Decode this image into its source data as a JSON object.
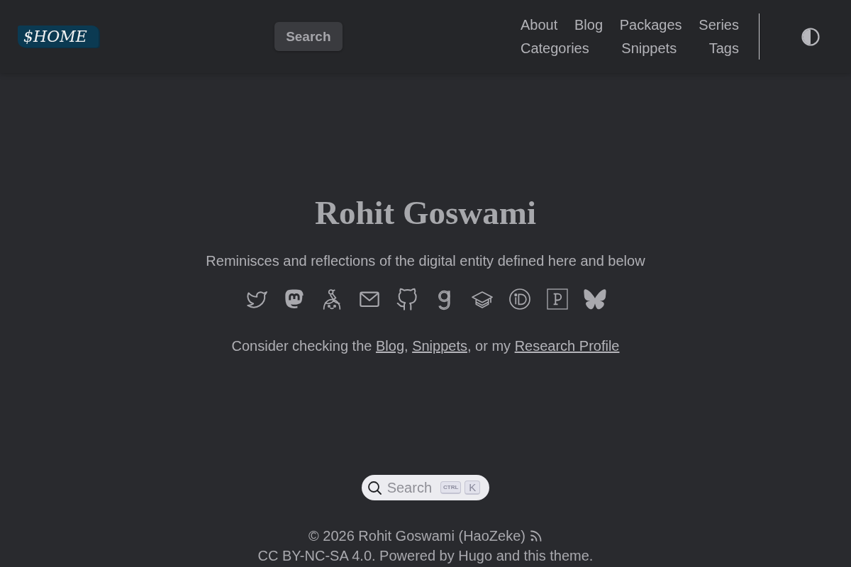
{
  "header": {
    "logo": "$HOME",
    "search_button": "Search",
    "nav": [
      "About",
      "Blog",
      "Packages",
      "Series",
      "Categories",
      "Snippets",
      "Tags"
    ]
  },
  "hero": {
    "title": "Rohit Goswami",
    "subtitle": "Reminisces and reflections of the digital entity defined here and below",
    "social_links": [
      {
        "kind": "bird"
      },
      {
        "kind": "bubble-m"
      },
      {
        "kind": "figure"
      },
      {
        "kind": "envelope"
      },
      {
        "kind": "cat"
      },
      {
        "kind": "letter-g"
      },
      {
        "kind": "mortarboard"
      },
      {
        "kind": "id-circle"
      },
      {
        "kind": "p-square"
      },
      {
        "kind": "butterfly"
      }
    ],
    "cta": [
      {
        "kind": "text",
        "text": "Consider checking the "
      },
      {
        "kind": "link",
        "text": "Blog"
      },
      {
        "kind": "text",
        "text": ", "
      },
      {
        "kind": "link",
        "text": "Snippets"
      },
      {
        "kind": "text",
        "text": ", or my "
      },
      {
        "kind": "link",
        "text": "Research Profile"
      }
    ]
  },
  "search_button": {
    "label": "Search",
    "keys": [
      "CTRL",
      "K"
    ]
  },
  "footer": {
    "copyright": "© 2026 Rohit Goswami (HaoZeke)",
    "license": "CC BY-NC-SA 4.0. Powered by Hugo and this theme."
  }
}
